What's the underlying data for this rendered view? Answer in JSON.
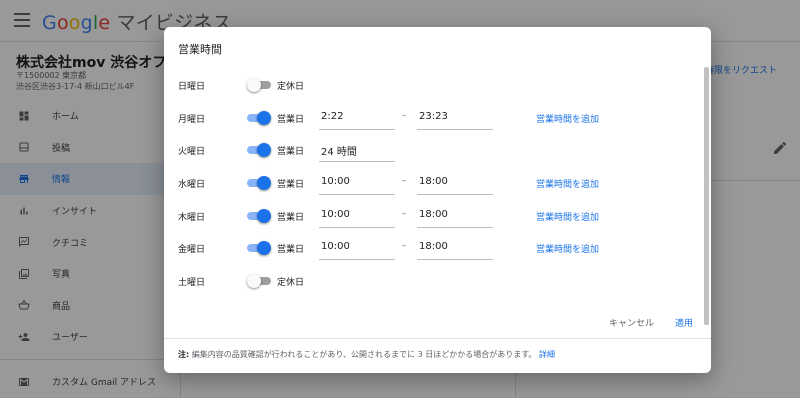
{
  "app": {
    "brand_google": [
      "G",
      "o",
      "o",
      "g",
      "l",
      "e"
    ],
    "brand_suffix": "マイビジネス"
  },
  "business": {
    "name": "株式会社mov 渋谷オフィス",
    "postal": "〒1500002 東京都",
    "address": "渋谷区渋谷3-17-4 新山口ビル4F"
  },
  "sidebar": {
    "items": [
      {
        "label": "ホーム",
        "icon": "dashboard-icon"
      },
      {
        "label": "投稿",
        "icon": "posts-icon"
      },
      {
        "label": "情報",
        "icon": "storefront-icon"
      },
      {
        "label": "インサイト",
        "icon": "insights-icon"
      },
      {
        "label": "クチコミ",
        "icon": "reviews-icon"
      },
      {
        "label": "写真",
        "icon": "photos-icon"
      },
      {
        "label": "商品",
        "icon": "basket-icon"
      },
      {
        "label": "ユーザー",
        "icon": "add-user-icon"
      }
    ],
    "gmail_item": {
      "label": "カスタム Gmail アドレス",
      "icon": "gmail-icon"
    }
  },
  "right_link": "権限をリクエスト",
  "colors": {
    "accent": "#1a73e8",
    "switch_track_on": "#8ab4f8",
    "switch_off": "#9e9e9e",
    "nav_active_bg": "#e8f0fe"
  },
  "dialog": {
    "title": "営業時間",
    "rows": [
      {
        "day": "日曜日",
        "open": false,
        "state": "定休日"
      },
      {
        "day": "月曜日",
        "open": true,
        "state": "営業日",
        "from": "2:22",
        "to": "23:23",
        "add": "営業時間を追加"
      },
      {
        "day": "火曜日",
        "open": true,
        "state": "営業日",
        "allday": "24 時間"
      },
      {
        "day": "水曜日",
        "open": true,
        "state": "営業日",
        "from": "10:00",
        "to": "18:00",
        "add": "営業時間を追加"
      },
      {
        "day": "木曜日",
        "open": true,
        "state": "営業日",
        "from": "10:00",
        "to": "18:00",
        "add": "営業時間を追加"
      },
      {
        "day": "金曜日",
        "open": true,
        "state": "営業日",
        "from": "10:00",
        "to": "18:00",
        "add": "営業時間を追加"
      },
      {
        "day": "土曜日",
        "open": false,
        "state": "定休日"
      }
    ],
    "separator": "–",
    "cancel": "キャンセル",
    "apply": "適用",
    "note_label": "注:",
    "note_text": " 編集内容の品質確認が行われることがあり、公開されるまでに 3 日ほどかかる場合があります。",
    "note_link": "詳細"
  }
}
